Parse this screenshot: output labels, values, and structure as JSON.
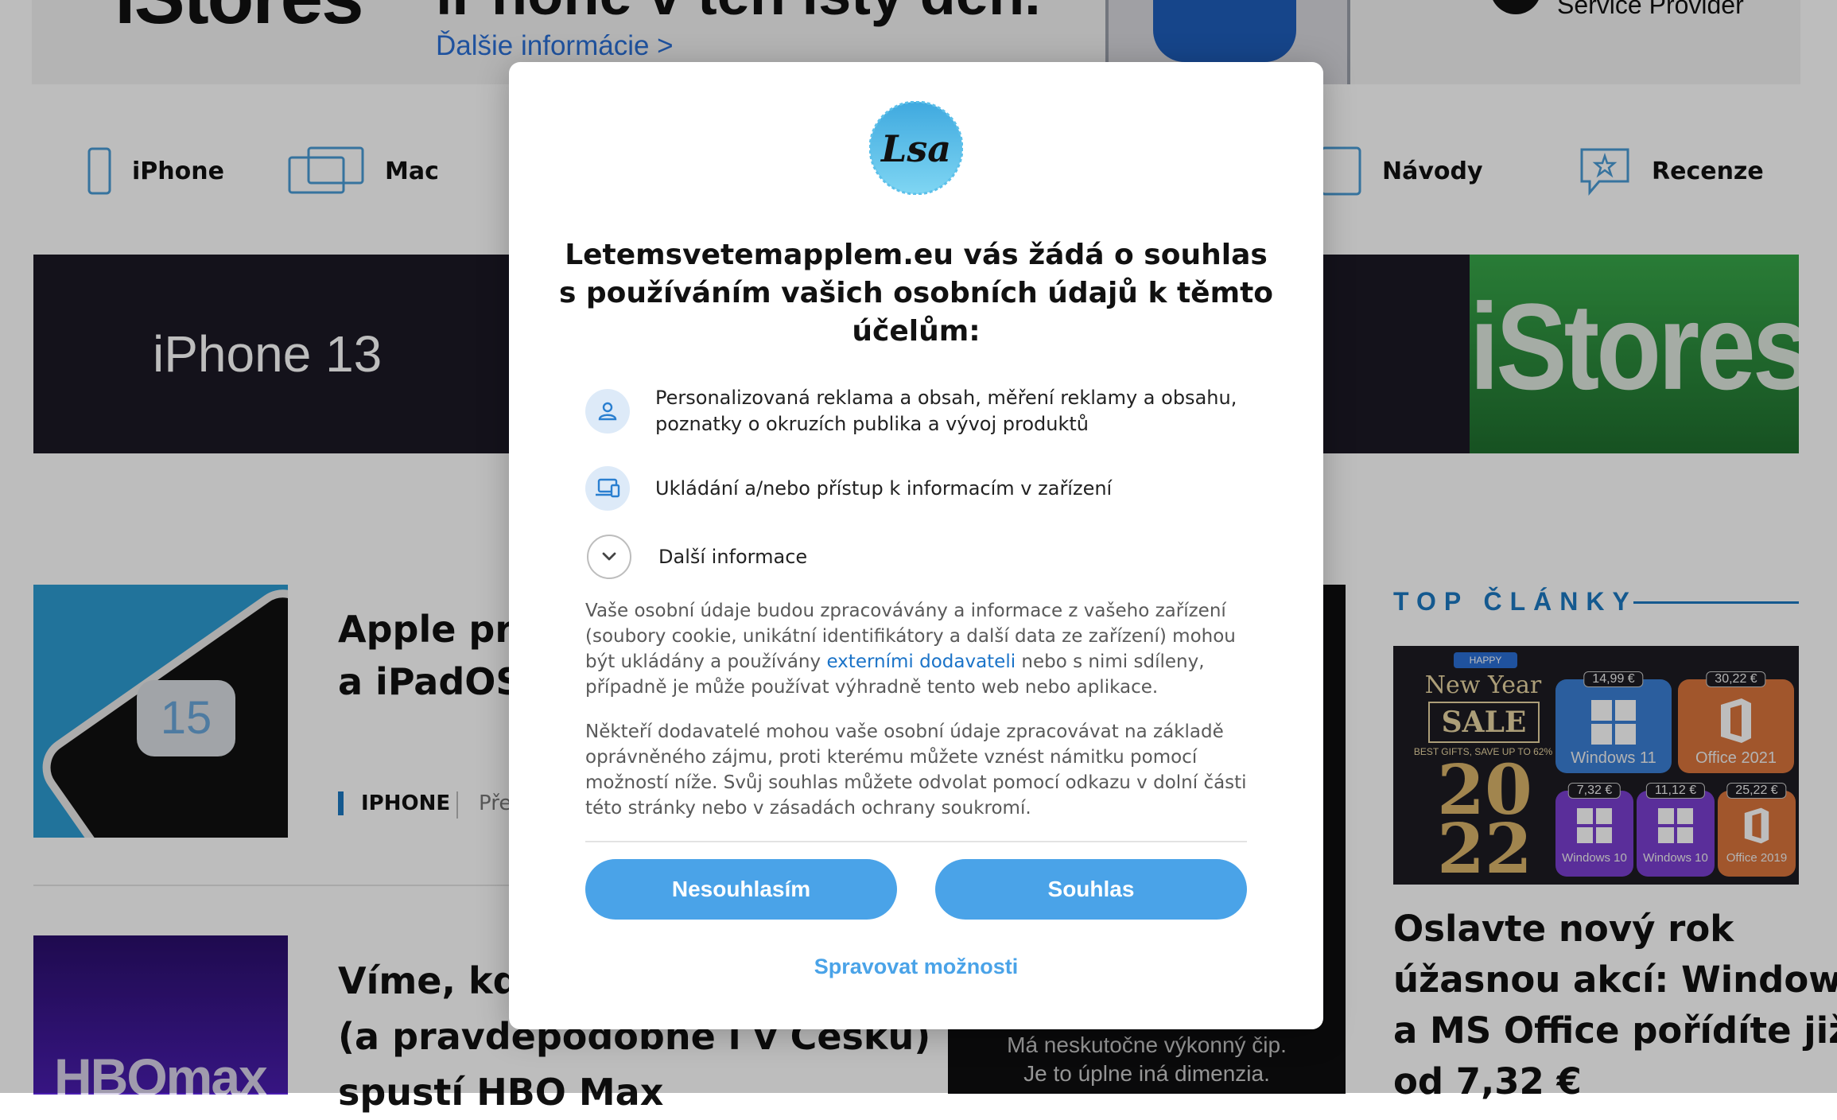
{
  "top_banner": {
    "brand": "iStores",
    "headline": "iPhone v ten istý deň.",
    "more_link": "Ďalšie informácie >",
    "provider": "Service Provider"
  },
  "nav": {
    "items": [
      {
        "label": "iPhone",
        "icon": "iphone-icon"
      },
      {
        "label": "Mac",
        "icon": "mac-icon"
      },
      {
        "label": "Návody",
        "icon": "tablet-icon"
      },
      {
        "label": "Recenze",
        "icon": "review-icon"
      }
    ]
  },
  "hero": {
    "title": "iPhone 13",
    "brand": "iStores"
  },
  "articles": [
    {
      "title_line1": "Apple práv",
      "title_line2": "a iPadOS 1",
      "category": "IPHONE",
      "sub": "Pře",
      "thumb_logo": "15"
    },
    {
      "title_line1": "Víme, kdy",
      "title_line2": "(a pravděpodobně i v Česku)",
      "title_line3": "spustí HBO Max",
      "thumb_logo": "HBOmax"
    }
  ],
  "mid_ad": {
    "line1": "Má neskutočne výkonný čip.",
    "line2": "Je to úplne iná dimenzia."
  },
  "sidebar": {
    "label": "TOP ČLÁNKY",
    "sale": {
      "badge": "HAPPY",
      "title": "New Year",
      "box": "SALE",
      "sub": "BEST GIFTS, SAVE UP TO 62%",
      "year_top": "20",
      "year_bottom": "22",
      "tiles": [
        {
          "price": "14,99 €",
          "name": "Windows 11"
        },
        {
          "price": "30,22 €",
          "name": "Office 2021"
        },
        {
          "price": "7,32 €",
          "name": "Windows 10"
        },
        {
          "price": "11,12 €",
          "name": "Windows 10"
        },
        {
          "price": "25,22 €",
          "name": "Office 2019"
        }
      ]
    },
    "article_title": [
      "Oslavte nový rok",
      "úžasnou akcí: Windows",
      "a MS Office pořídíte již",
      "od 7,32 €"
    ]
  },
  "dialog": {
    "logo_text": "Lsa",
    "title": "Letemsvetemapplem.eu vás žádá o souhlas s používáním vašich osobních údajů k těmto účelům:",
    "purposes": [
      {
        "icon": "person-icon",
        "text": "Personalizovaná reklama a obsah, měření reklamy a obsahu, poznatky o okruzích publika a vývoj produktů"
      },
      {
        "icon": "devices-icon",
        "text": "Ukládání a/nebo přístup k informacím v zařízení"
      }
    ],
    "more_info": "Další informace",
    "para1_a": "Vaše osobní údaje budou zpracovávány a informace z vašeho zařízení (soubory cookie, unikátní identifikátory a další data ze zařízení) mohou být ukládány a používány ",
    "para1_link": "externími dodavateli",
    "para1_b": " nebo s nimi sdíleny, případně je může používat výhradně tento web nebo aplikace.",
    "para2": "Někteří dodavatelé mohou vaše osobní údaje zpracovávat na základě oprávněného zájmu, proti kterému můžete vznést námitku pomocí možností níže. Svůj souhlas můžete odvolat pomocí odkazu v dolní části této stránky nebo v zásadách ochrany soukromí.",
    "decline_label": "Nesouhlasím",
    "accept_label": "Souhlas",
    "manage_label": "Spravovat možnosti",
    "accent_color": "#4aa3e8"
  }
}
